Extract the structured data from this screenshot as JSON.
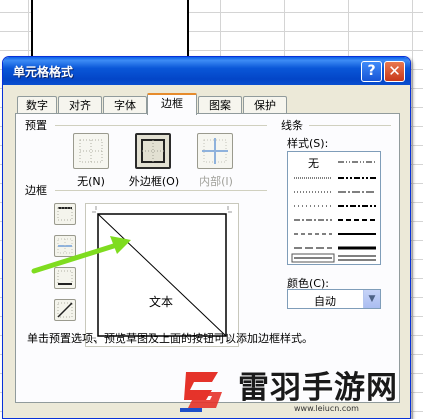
{
  "dialog": {
    "title": "单元格格式",
    "help_label": "?",
    "close_label": "✕"
  },
  "tabs": [
    {
      "label": "数字"
    },
    {
      "label": "对齐"
    },
    {
      "label": "字体"
    },
    {
      "label": "边框",
      "active": true
    },
    {
      "label": "图案"
    },
    {
      "label": "保护"
    }
  ],
  "presets": {
    "group_label": "预置",
    "items": [
      {
        "label": "无(N)"
      },
      {
        "label": "外边框(O)"
      },
      {
        "label": "内部(I)"
      }
    ]
  },
  "border": {
    "group_label": "边框",
    "preview_text": "文本"
  },
  "line": {
    "group_label": "线条",
    "style_label": "样式(S):",
    "none_label": "无",
    "color_label": "颜色(C):",
    "color_value": "自动"
  },
  "hint": "单击预置选项、预览草图及上面的按钮可以添加边框样式。",
  "watermark": {
    "site_name": "雷羽手游网",
    "url": "www.leiucn.com"
  },
  "colors": {
    "titlebar": "#0a57d8",
    "dialog_bg": "#ece9d8",
    "active_tab_accent": "#e68b2c",
    "annotation_arrow": "#7fdc1f"
  }
}
